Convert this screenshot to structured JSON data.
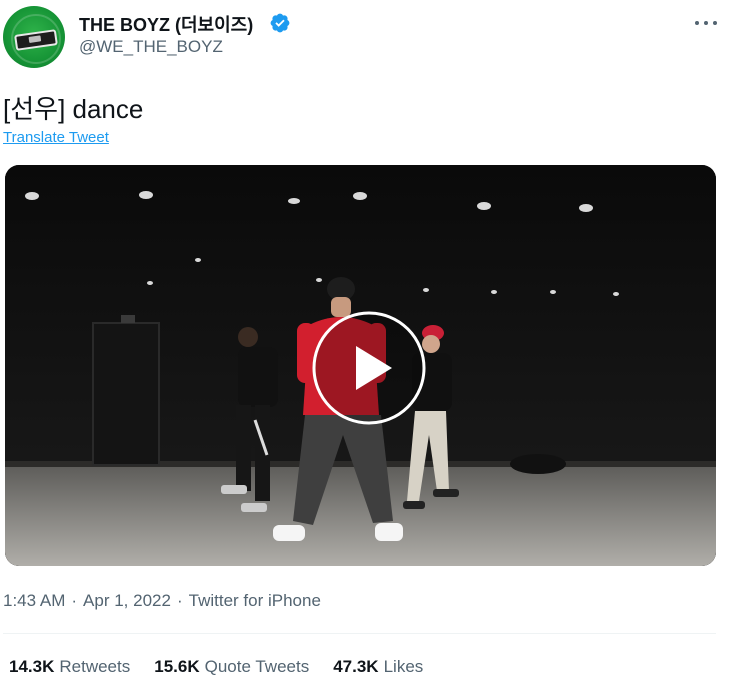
{
  "author": {
    "display_name": "THE BOYZ (더보이즈)",
    "handle": "@WE_THE_BOYZ",
    "verified": true,
    "verified_color": "#1d9bf0",
    "avatar_icon": "green-ring-avatar"
  },
  "menu": {
    "icon": "more-options-icon"
  },
  "tweet": {
    "text": "[선우] dance",
    "translate_label": "Translate Tweet"
  },
  "media": {
    "type": "video",
    "play_icon": "play-icon"
  },
  "meta": {
    "time": "1:43 AM",
    "date": "Apr 1, 2022",
    "source": "Twitter for iPhone",
    "separator": "·"
  },
  "stats": [
    {
      "value": "14.3K",
      "label": "Retweets"
    },
    {
      "value": "15.6K",
      "label": "Quote Tweets"
    },
    {
      "value": "47.3K",
      "label": "Likes"
    }
  ],
  "colors": {
    "text_primary": "#0f1419",
    "text_secondary": "#536471",
    "link": "#1d9bf0",
    "avatar_green": "#169436"
  }
}
